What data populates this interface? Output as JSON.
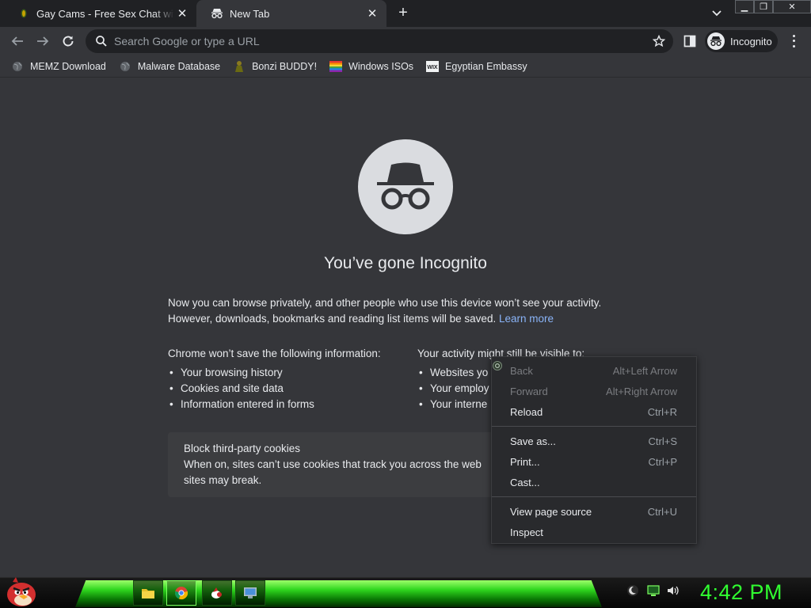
{
  "tabs": [
    {
      "title": "Gay Cams - Free Sex Chat with Sexy",
      "icon": "cam-site-favicon",
      "active": false
    },
    {
      "title": "New Tab",
      "icon": "incognito-icon",
      "active": true
    }
  ],
  "window_controls": {
    "minimize": "▁",
    "restore": "❐",
    "close": "✕"
  },
  "omnibox": {
    "placeholder": "Search Google or type a URL",
    "value": ""
  },
  "profile": {
    "label": "Incognito"
  },
  "bookmarks": [
    {
      "label": "MEMZ Download",
      "icon": "globe-icon"
    },
    {
      "label": "Malware Database",
      "icon": "globe-icon"
    },
    {
      "label": "Bonzi BUDDY!",
      "icon": "bonzi-icon"
    },
    {
      "label": "Windows ISOs",
      "icon": "windows-flag-icon"
    },
    {
      "label": "Egyptian Embassy",
      "icon": "wix-icon"
    }
  ],
  "incognito_page": {
    "headline": "You’ve gone Incognito",
    "para_line1": "Now you can browse privately, and other people who use this device won’t see your activity.",
    "para_line2": "However, downloads, bookmarks and reading list items will be saved.",
    "learn_more": "Learn more",
    "col1_title": "Chrome won’t save the following information:",
    "col1_items": [
      "Your browsing history",
      "Cookies and site data",
      "Information entered in forms"
    ],
    "col2_title": "Your activity might still be visible to:",
    "col2_items": [
      "Websites yo",
      "Your employ",
      "Your interne"
    ],
    "cookies_title": "Block third-party cookies",
    "cookies_line1": "When on, sites can’t use cookies that track you across the web",
    "cookies_line2": "sites may break."
  },
  "context_menu": {
    "group1": [
      {
        "label": "Back",
        "shortcut": "Alt+Left Arrow",
        "disabled": true
      },
      {
        "label": "Forward",
        "shortcut": "Alt+Right Arrow",
        "disabled": true
      },
      {
        "label": "Reload",
        "shortcut": "Ctrl+R",
        "disabled": false
      }
    ],
    "group2": [
      {
        "label": "Save as...",
        "shortcut": "Ctrl+S"
      },
      {
        "label": "Print...",
        "shortcut": "Ctrl+P"
      },
      {
        "label": "Cast...",
        "shortcut": ""
      }
    ],
    "group3": [
      {
        "label": "View page source",
        "shortcut": "Ctrl+U"
      },
      {
        "label": "Inspect",
        "shortcut": ""
      }
    ]
  },
  "taskbar": {
    "clock": "4:42 PM",
    "apps": [
      "folder-icon",
      "chrome-icon",
      "app-icon",
      "monitor-app-icon"
    ],
    "accent": "#30ff30"
  }
}
